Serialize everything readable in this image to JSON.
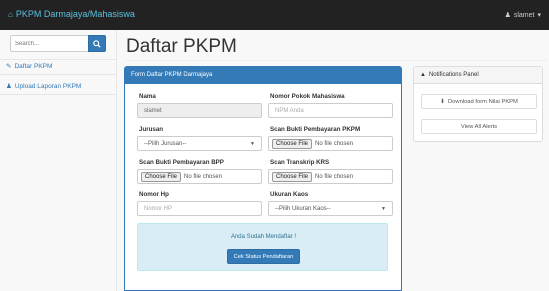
{
  "navbar": {
    "brand": "PKPM Darmajaya/Mahasiswa",
    "user": "slamet"
  },
  "sidebar": {
    "search_placeholder": "Search...",
    "items": [
      {
        "label": "Daftar PKPM",
        "icon": "edit-icon"
      },
      {
        "label": "Upload Laporan PKPM",
        "icon": "user-icon"
      }
    ]
  },
  "page": {
    "title": "Daftar PKPM"
  },
  "form": {
    "heading": "Form Daftar PKPM Darmajaya",
    "nama_label": "Nama",
    "nama_value": "slamet",
    "npm_label": "Nomor Pokok Mahasiswa",
    "npm_placeholder": "NPM Anda",
    "jurusan_label": "Jurusan",
    "jurusan_value": "--Pilih Jurusan--",
    "bukti_pkpm_label": "Scan Bukti Pembayaran PKPM",
    "bukti_bpp_label": "Scan Bukti Pembayaran BPP",
    "transkrip_label": "Scan Transkrip KRS",
    "file_button": "Choose File",
    "file_status": "No file chosen",
    "hp_label": "Nomor Hp",
    "hp_placeholder": "Nomor HP",
    "kaos_label": "Ukuran Kaos",
    "kaos_value": "--Pilih Ukuran Kaos--",
    "alert_text": "Anda Sudah Mendaftar !",
    "status_button": "Cek Status Pendaftaran"
  },
  "notifications": {
    "heading": "Notifications Panel",
    "download_label": "Download form Nilai PKPM",
    "view_all_label": "View All Alerts"
  }
}
